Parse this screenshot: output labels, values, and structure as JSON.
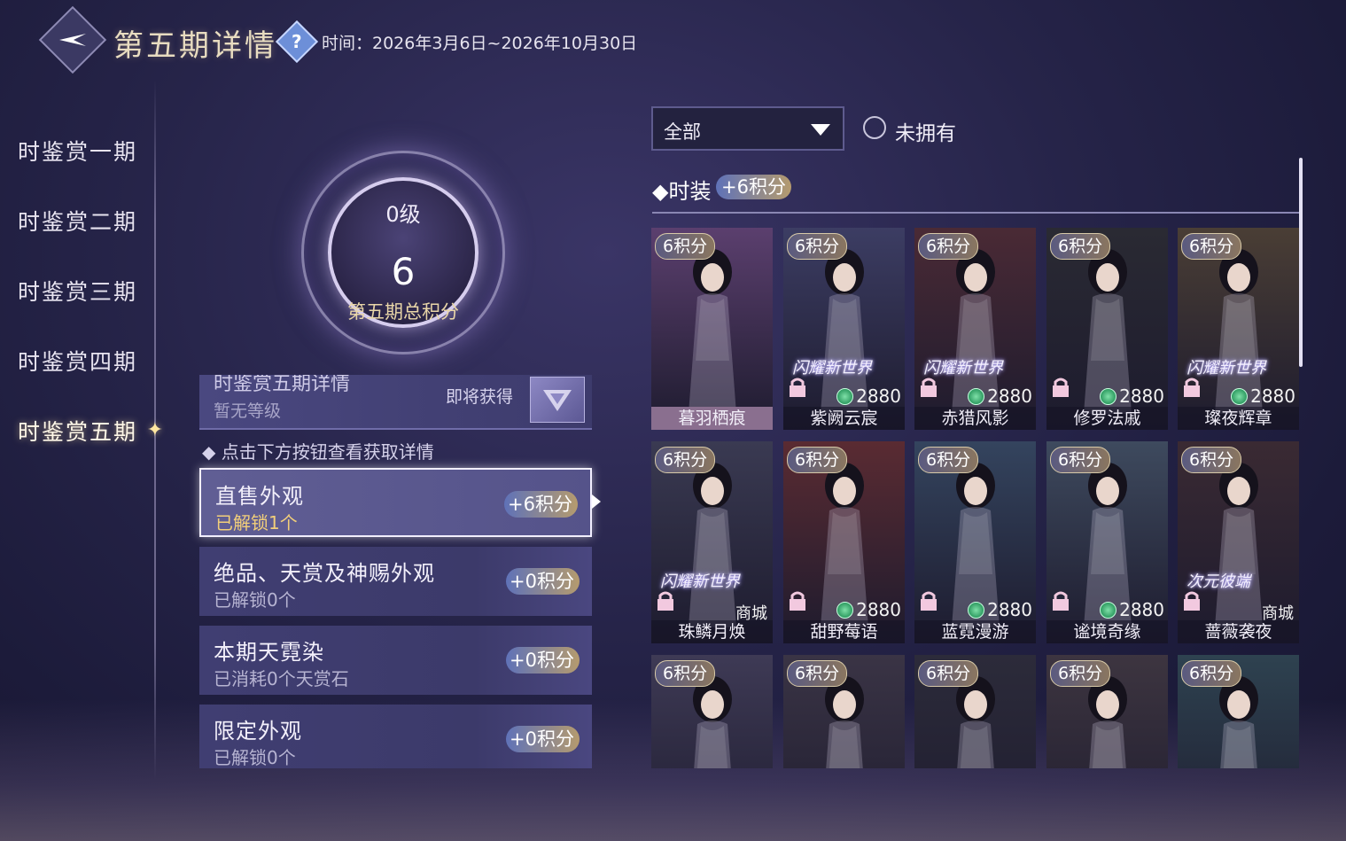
{
  "header": {
    "title": "第五期详情",
    "help_symbol": "?",
    "time_text": "时间：2026年3月6日~2026年10月30日"
  },
  "sidebar": {
    "items": [
      {
        "label": "时鉴赏一期"
      },
      {
        "label": "时鉴赏二期"
      },
      {
        "label": "时鉴赏三期"
      },
      {
        "label": "时鉴赏四期"
      },
      {
        "label": "时鉴赏五期"
      }
    ],
    "active_index": 4
  },
  "score": {
    "level": "0级",
    "total": "6",
    "caption": "第五期总积分"
  },
  "tier": {
    "title": "时鉴赏五期详情",
    "status": "暂无等级",
    "next_label": "即将获得"
  },
  "hint": "点击下方按钮查看获取详情",
  "categories": [
    {
      "title": "直售外观",
      "sub": "已解锁1个",
      "points": "+6积分"
    },
    {
      "title": "绝品、天赏及神赐外观",
      "sub": "已解锁0个",
      "points": "+0积分"
    },
    {
      "title": "本期天霓染",
      "sub": "已消耗0个天赏石",
      "points": "+0积分"
    },
    {
      "title": "限定外观",
      "sub": "已解锁0个",
      "points": "+0积分"
    }
  ],
  "filter": {
    "dropdown_value": "全部",
    "not_owned_label": "未拥有"
  },
  "section": {
    "title": "时装",
    "bonus": "+6积分"
  },
  "cards": [
    {
      "points": "6积分",
      "name": "暮羽栖痕",
      "promo": "",
      "price": "",
      "shop": "",
      "owned": true,
      "color": "#5b3f6e"
    },
    {
      "points": "6积分",
      "name": "紫阙云宸",
      "promo": "闪耀新世界",
      "price": "2880",
      "shop": "",
      "owned": false,
      "color": "#3c3d63"
    },
    {
      "points": "6积分",
      "name": "赤猎风影",
      "promo": "闪耀新世界",
      "price": "2880",
      "shop": "",
      "owned": false,
      "color": "#4a2a35"
    },
    {
      "points": "6积分",
      "name": "修罗法戚",
      "promo": "",
      "price": "2880",
      "shop": "",
      "owned": false,
      "color": "#2a2a33"
    },
    {
      "points": "6积分",
      "name": "璨夜辉章",
      "promo": "闪耀新世界",
      "price": "2880",
      "shop": "",
      "owned": false,
      "color": "#4a3e35"
    },
    {
      "points": "6积分",
      "name": "珠鳞月焕",
      "promo": "闪耀新世界",
      "price": "",
      "shop": "商城",
      "owned": false,
      "color": "#3a3a52"
    },
    {
      "points": "6积分",
      "name": "甜野莓语",
      "promo": "",
      "price": "2880",
      "shop": "",
      "owned": false,
      "color": "#5a2b32"
    },
    {
      "points": "6积分",
      "name": "蓝霓漫游",
      "promo": "",
      "price": "2880",
      "shop": "",
      "owned": false,
      "color": "#34445e"
    },
    {
      "points": "6积分",
      "name": "谧境奇缘",
      "promo": "",
      "price": "2880",
      "shop": "",
      "owned": false,
      "color": "#3e4a5e"
    },
    {
      "points": "6积分",
      "name": "蔷薇袭夜",
      "promo": "次元彼端",
      "price": "",
      "shop": "商城",
      "owned": false,
      "color": "#3a2a33"
    },
    {
      "points": "6积分",
      "name": "",
      "promo": "",
      "price": "",
      "shop": "",
      "owned": false,
      "color": "#3e3a55"
    },
    {
      "points": "6积分",
      "name": "",
      "promo": "",
      "price": "",
      "shop": "",
      "owned": false,
      "color": "#3a3445"
    },
    {
      "points": "6积分",
      "name": "",
      "promo": "",
      "price": "",
      "shop": "",
      "owned": false,
      "color": "#2c2b3a"
    },
    {
      "points": "6积分",
      "name": "",
      "promo": "",
      "price": "",
      "shop": "",
      "owned": false,
      "color": "#3d3540"
    },
    {
      "points": "6积分",
      "name": "",
      "promo": "",
      "price": "",
      "shop": "",
      "owned": false,
      "color": "#2e4250"
    }
  ]
}
